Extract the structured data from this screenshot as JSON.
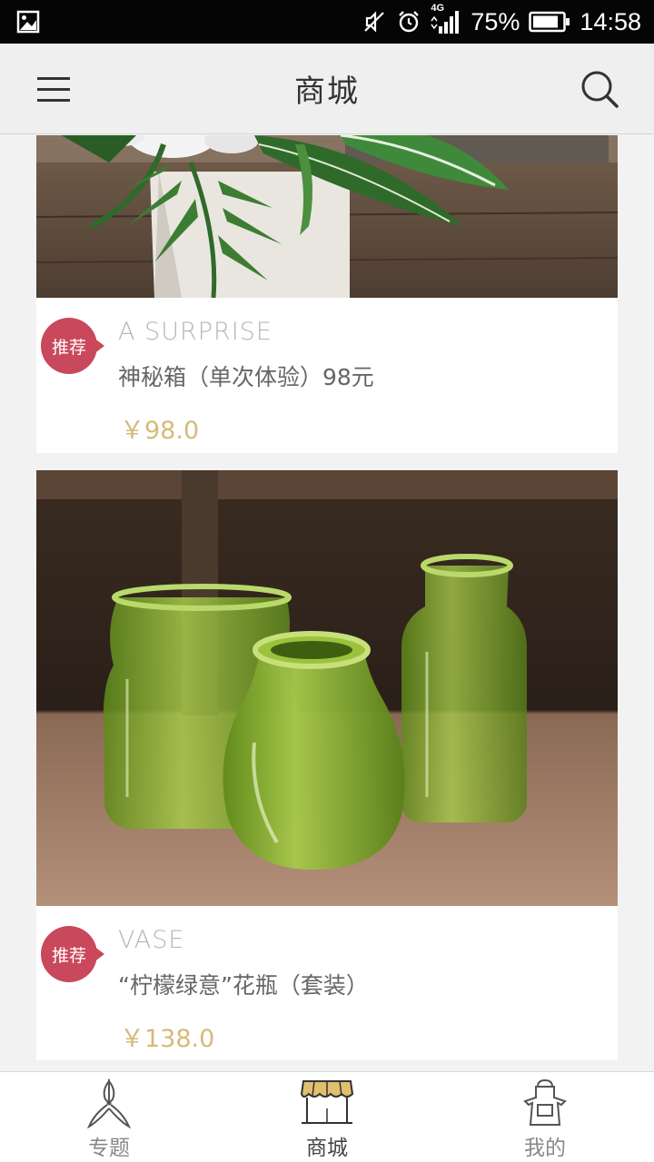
{
  "status_bar": {
    "battery": "75%",
    "network": "4G",
    "time": "14:58"
  },
  "header": {
    "title": "商城"
  },
  "products": [
    {
      "badge": "推荐",
      "en_title": "A SURPRISE",
      "cn_title": "神秘箱（单次体验）98元",
      "price": "￥98.0"
    },
    {
      "badge": "推荐",
      "en_title": "VASE",
      "cn_title": "“柠檬绿意”花瓶（套装）",
      "price": "￥138.0"
    }
  ],
  "tabs": [
    {
      "label": "专题",
      "icon": "pruning-shears-icon"
    },
    {
      "label": "商城",
      "icon": "shop-awning-icon",
      "active": true
    },
    {
      "label": "我的",
      "icon": "apron-icon"
    }
  ],
  "colors": {
    "badge": "#c9485b",
    "price": "#d8b979",
    "awning": "#e0c070"
  }
}
